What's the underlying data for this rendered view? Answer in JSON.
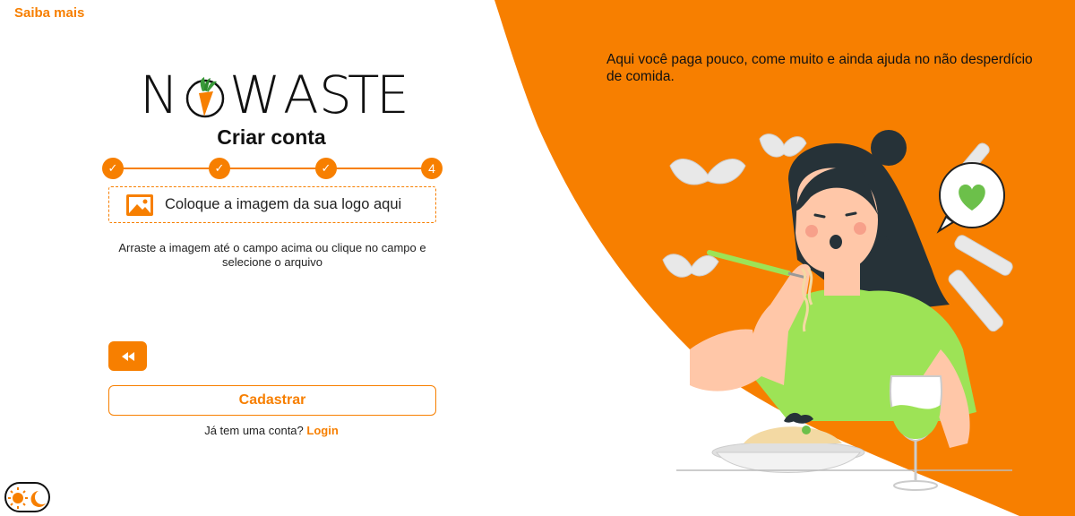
{
  "header": {
    "saiba_mais": "Saiba mais"
  },
  "logo": {
    "letters": [
      "N",
      "W",
      "A",
      "S",
      "T",
      "E"
    ]
  },
  "form": {
    "title": "Criar conta",
    "steps": [
      {
        "state": "done",
        "label": "✓"
      },
      {
        "state": "done",
        "label": "✓"
      },
      {
        "state": "done",
        "label": "✓"
      },
      {
        "state": "current",
        "label": "4"
      }
    ],
    "upload_label": "Coloque a imagem da sua logo aqui",
    "hint": "Arraste a imagem até o campo acima ou clique no campo e selecione o arquivo",
    "submit_label": "Cadastrar",
    "account_prompt": "Já tem uma conta?",
    "login_label": "Login"
  },
  "right": {
    "tagline": "Aqui você paga pouco, come muito e ainda ajuda no não desperdício de comida."
  },
  "colors": {
    "accent": "#f77f00",
    "green": "#9de356",
    "text": "#111111"
  },
  "icons": {
    "back": "rewind-icon",
    "upload": "image-icon",
    "theme": "sun-moon-icon"
  }
}
